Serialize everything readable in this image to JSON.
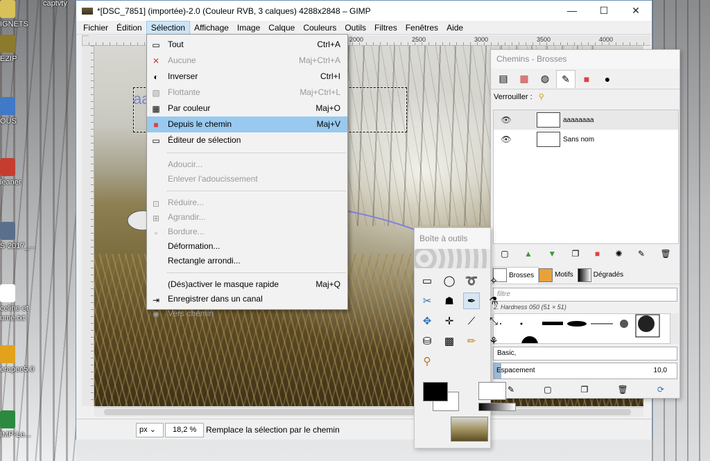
{
  "desktop": {
    "icons": [
      {
        "label": "IGNETS",
        "color": "#d8c15a"
      },
      {
        "label": "EZIP",
        "color": "#8c7a2d"
      },
      {
        "label": "OUS",
        "color": "#3f79c8"
      },
      {
        "label": "leaner",
        "color": "#c63d2f"
      },
      {
        "label": "S-2017_...",
        "color": "#5a6f8c"
      },
      {
        "label": "celine et ume.txt",
        "color": "#ffffff"
      },
      {
        "label": "erapee5.0",
        "color": "#e2a21b"
      },
      {
        "label": "IMP-Le...",
        "color": "#2b8a3e"
      }
    ],
    "top_label": "captvty"
  },
  "window": {
    "title": "*[DSC_7851] (importée)-2.0 (Couleur RVB, 3 calques) 4288x2848 – GIMP",
    "minimize": "—",
    "maximize": "☐",
    "close": "✕"
  },
  "menubar": [
    "Fichier",
    "Édition",
    "Sélection",
    "Affichage",
    "Image",
    "Calque",
    "Couleurs",
    "Outils",
    "Filtres",
    "Fenêtres",
    "Aide"
  ],
  "ruler": {
    "marks": [
      "2000",
      "2500",
      "3000",
      "3500",
      "4000"
    ]
  },
  "canvas": {
    "text": "aaaaaaaa"
  },
  "selection_menu": {
    "items": [
      {
        "label": "Tout",
        "shortcut": "Ctrl+A",
        "icon": "▭",
        "disabled": false
      },
      {
        "label": "Aucune",
        "shortcut": "Maj+Ctrl+A",
        "icon": "✕",
        "disabled": true
      },
      {
        "label": "Inverser",
        "shortcut": "Ctrl+I",
        "icon": "◐",
        "disabled": false
      },
      {
        "label": "Flottante",
        "shortcut": "Maj+Ctrl+L",
        "icon": "▧",
        "disabled": true
      },
      {
        "label": "Par couleur",
        "shortcut": "Maj+O",
        "icon": "▦",
        "disabled": false
      },
      {
        "label": "Depuis le chemin",
        "shortcut": "Maj+V",
        "icon": "■",
        "disabled": false
      },
      {
        "label": "Éditeur de sélection",
        "shortcut": "",
        "icon": "▭",
        "disabled": false
      },
      {
        "label": "Adoucir...",
        "shortcut": "",
        "icon": "",
        "disabled": true
      },
      {
        "label": "Enlever l'adoucissement",
        "shortcut": "",
        "icon": "",
        "disabled": true
      },
      {
        "label": "Réduire...",
        "shortcut": "",
        "icon": "⊡",
        "disabled": true
      },
      {
        "label": "Agrandir...",
        "shortcut": "",
        "icon": "⊞",
        "disabled": true
      },
      {
        "label": "Bordure...",
        "shortcut": "",
        "icon": "▫",
        "disabled": true
      },
      {
        "label": "Déformation...",
        "shortcut": "",
        "icon": "",
        "disabled": false
      },
      {
        "label": "Rectangle arrondi...",
        "shortcut": "",
        "icon": "",
        "disabled": false
      },
      {
        "label": "(Dés)activer le masque rapide",
        "shortcut": "Maj+Q",
        "icon": "",
        "disabled": false
      },
      {
        "label": "Enregistrer dans un canal",
        "shortcut": "",
        "icon": "⇥",
        "disabled": false
      },
      {
        "label": "Vers chemin",
        "shortcut": "",
        "icon": "✺",
        "disabled": true
      }
    ]
  },
  "paths_dock": {
    "title": "Chemins - Brosses",
    "lock_label": "Verrouiller :",
    "paths": [
      {
        "name": "aaaaaaaa",
        "selected": true
      },
      {
        "name": "Sans nom",
        "selected": false
      }
    ],
    "brush_tabs": [
      "Brosses",
      "Motifs",
      "Dégradés"
    ],
    "filter_placeholder": "filtre",
    "brush_name": "2. Hardness 050 (51 × 51)",
    "preset": "Basic,",
    "spacing_label": "Espacement",
    "spacing_value": "10,0",
    "spacing_fraction": 0.04
  },
  "toolbox": {
    "title": "Boîte à outils"
  },
  "statusbar": {
    "unit": "px",
    "zoom": "18,2 %",
    "message": "Remplace la sélection par le chemin"
  }
}
